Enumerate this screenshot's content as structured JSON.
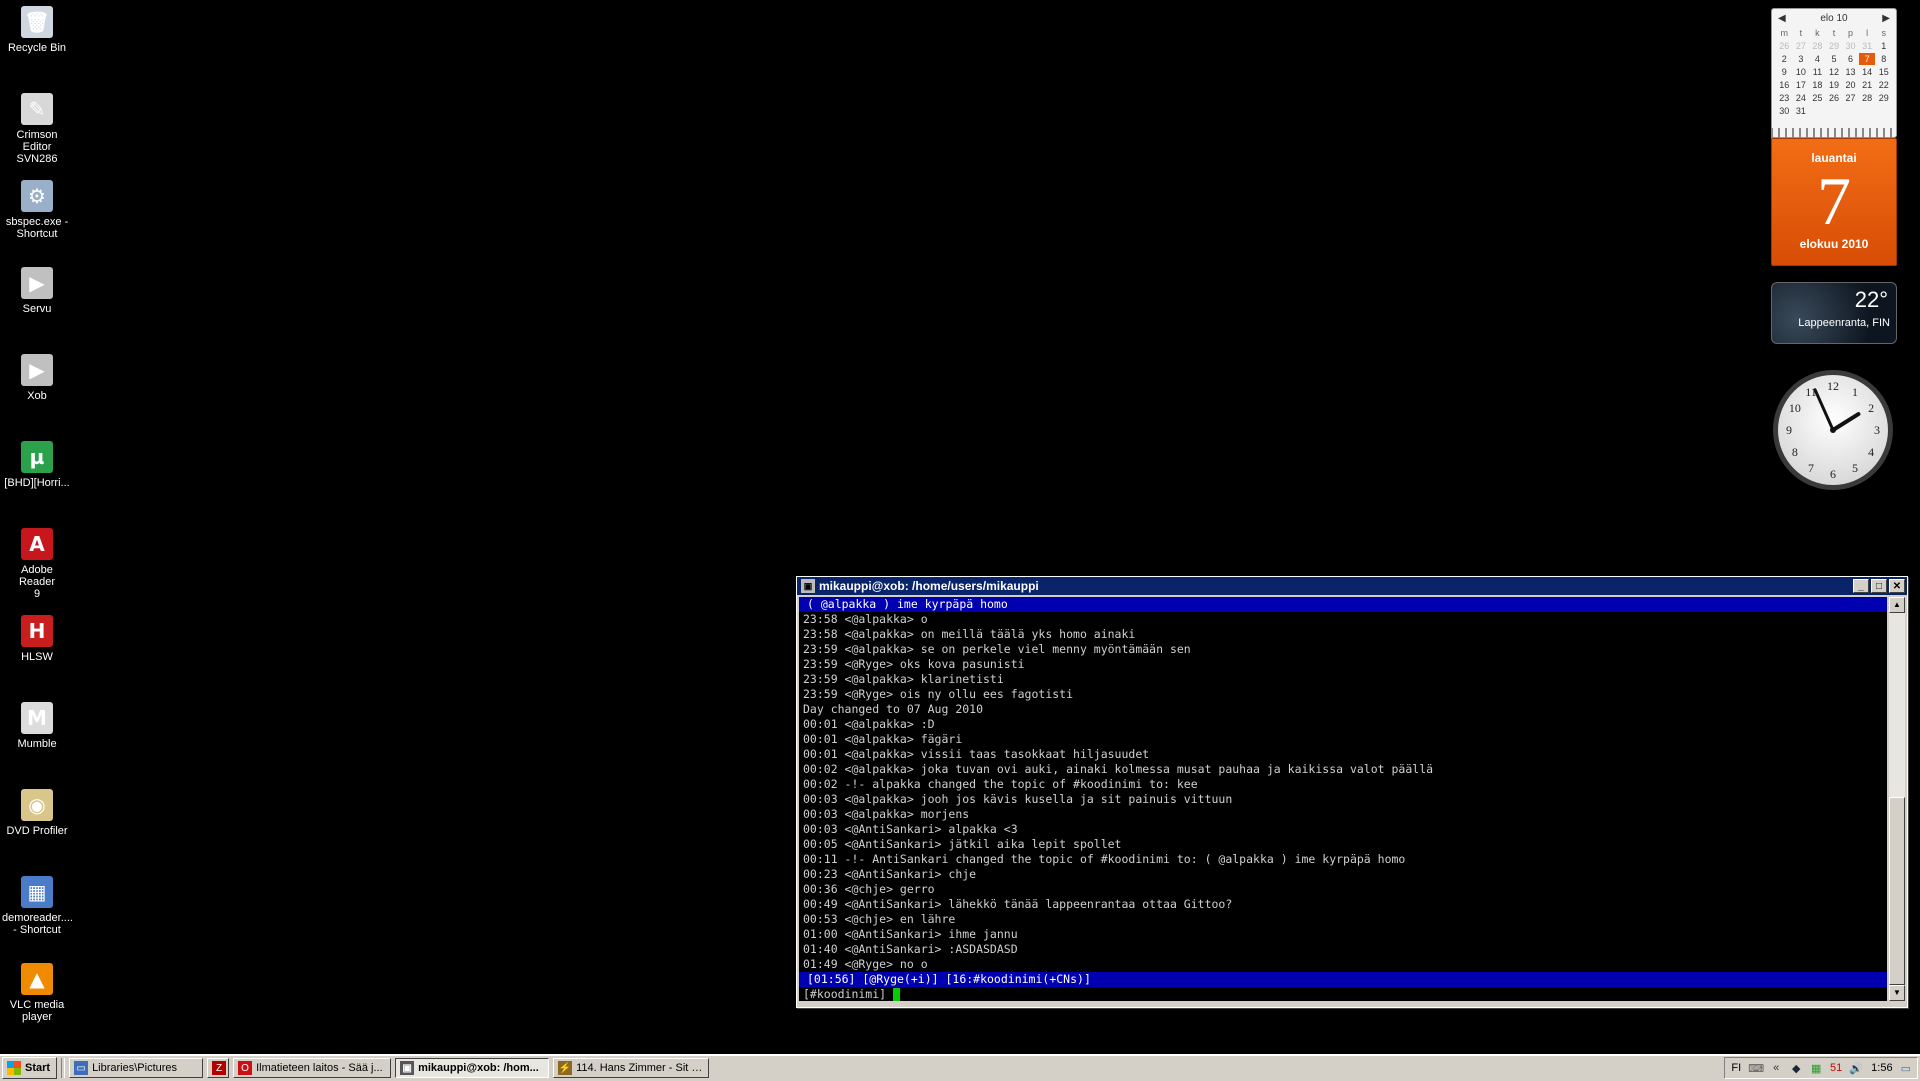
{
  "desktop": {
    "icons": [
      {
        "label": "Recycle Bin",
        "glyph": "🗑",
        "color": "#cfd8e0",
        "icon": "recycle-bin-icon"
      },
      {
        "label": "Crimson Editor\nSVN286",
        "glyph": "✎",
        "color": "#d8d8d8",
        "icon": "crimson-editor-icon"
      },
      {
        "label": "sbspec.exe -\nShortcut",
        "glyph": "⚙",
        "color": "#9ab0c8",
        "icon": "sbspec-icon"
      },
      {
        "label": "Servu",
        "glyph": "▶",
        "color": "#c0c0c0",
        "icon": "servu-icon"
      },
      {
        "label": "Xob",
        "glyph": "▶",
        "color": "#c0c0c0",
        "icon": "xob-icon"
      },
      {
        "label": "[BHD][Horri...",
        "glyph": "µ",
        "color": "#2aa14a",
        "icon": "utorrent-icon"
      },
      {
        "label": "Adobe Reader\n9",
        "glyph": "A",
        "color": "#c8161d",
        "icon": "adobe-reader-icon"
      },
      {
        "label": "HLSW",
        "glyph": "H",
        "color": "#c81e1e",
        "icon": "hlsw-icon"
      },
      {
        "label": "Mumble",
        "glyph": "M",
        "color": "#dcdcdc",
        "icon": "mumble-icon"
      },
      {
        "label": "DVD Profiler",
        "glyph": "◉",
        "color": "#d9c68a",
        "icon": "dvd-profiler-icon"
      },
      {
        "label": "demoreader....\n- Shortcut",
        "glyph": "▦",
        "color": "#4a7cc8",
        "icon": "demoreader-icon"
      },
      {
        "label": "VLC media\nplayer",
        "glyph": "▲",
        "color": "#f08a00",
        "icon": "vlc-icon"
      }
    ]
  },
  "calendar": {
    "month_label": "elo 10",
    "weekdays": [
      "m",
      "t",
      "k",
      "t",
      "p",
      "l",
      "s"
    ],
    "days": [
      {
        "d": "26",
        "muted": true
      },
      {
        "d": "27",
        "muted": true
      },
      {
        "d": "28",
        "muted": true
      },
      {
        "d": "29",
        "muted": true
      },
      {
        "d": "30",
        "muted": true
      },
      {
        "d": "31",
        "muted": true
      },
      {
        "d": "1"
      },
      {
        "d": "2"
      },
      {
        "d": "3"
      },
      {
        "d": "4"
      },
      {
        "d": "5"
      },
      {
        "d": "6"
      },
      {
        "d": "7",
        "today": true
      },
      {
        "d": "8"
      },
      {
        "d": "9"
      },
      {
        "d": "10"
      },
      {
        "d": "11"
      },
      {
        "d": "12"
      },
      {
        "d": "13"
      },
      {
        "d": "14"
      },
      {
        "d": "15"
      },
      {
        "d": "16"
      },
      {
        "d": "17"
      },
      {
        "d": "18"
      },
      {
        "d": "19"
      },
      {
        "d": "20"
      },
      {
        "d": "21"
      },
      {
        "d": "22"
      },
      {
        "d": "23"
      },
      {
        "d": "24"
      },
      {
        "d": "25"
      },
      {
        "d": "26"
      },
      {
        "d": "27"
      },
      {
        "d": "28"
      },
      {
        "d": "29"
      },
      {
        "d": "30"
      },
      {
        "d": "31"
      }
    ],
    "day_name": "lauantai",
    "day_number": "7",
    "month_year": "elokuu 2010"
  },
  "weather": {
    "temp": "22°",
    "location": "Lappeenranta, FIN"
  },
  "clock": {
    "hour": 1,
    "minute": 56
  },
  "terminal": {
    "title": "mikauppi@xob: /home/users/mikauppi",
    "topic": "( @alpakka ) ime kyrpäpä homo",
    "lines": [
      "23:58 <@alpakka> o",
      "23:58 <@alpakka> on meillä täälä yks homo ainaki",
      "23:59 <@alpakka> se on perkele viel menny myöntämään sen",
      "23:59 <@Ryge> oks kova pasunisti",
      "23:59 <@alpakka> klarinetisti",
      "23:59 <@Ryge> ois ny ollu ees fagotisti",
      "Day changed to 07 Aug 2010",
      "00:01 <@alpakka> :D",
      "00:01 <@alpakka> fägäri",
      "00:01 <@alpakka> vissii taas tasokkaat hiljasuudet",
      "00:02 <@alpakka> joka tuvan ovi auki, ainaki kolmessa musat pauhaa ja kaikissa valot päällä",
      "00:02 -!- alpakka changed the topic of #koodinimi to: kee",
      "00:03 <@alpakka> jooh jos kävis kusella ja sit painuis vittuun",
      "00:03 <@alpakka> morjens",
      "00:03 <@AntiSankari> alpakka <3",
      "00:05 <@AntiSankari> jätkil aika lepit spollet",
      "00:11 -!- AntiSankari changed the topic of #koodinimi to: ( @alpakka ) ime kyrpäpä homo",
      "00:23 <@AntiSankari> chje",
      "00:36 <@chje> gerro",
      "00:49 <@AntiSankari> lähekkö tänää lappeenrantaa ottaa Gittoo?",
      "00:53 <@chje> en lähre",
      "01:00 <@AntiSankari> ihme jannu",
      "01:40 <@AntiSankari> :ASDASDASD",
      "01:49 <@Ryge> no o"
    ],
    "status": "[01:56] [@Ryge(+i)] [16:#koodinimi(+CNs)]",
    "input_prompt": "[#koodinimi] "
  },
  "taskbar": {
    "start_label": "Start",
    "tasks": [
      {
        "label": "Libraries\\Pictures",
        "icon": "folder-icon",
        "glyph": "▭",
        "color": "#3d6fb6",
        "width": 134
      },
      {
        "label": "",
        "icon": "filezilla-icon",
        "glyph": "Z",
        "color": "#b00000",
        "width": 22
      },
      {
        "label": "Ilmatieteen laitos - Sää j...",
        "icon": "opera-icon",
        "glyph": "O",
        "color": "#cc0f16",
        "width": 158
      },
      {
        "label": "mikauppi@xob: /hom...",
        "icon": "putty-icon",
        "glyph": "▣",
        "color": "#555555",
        "width": 154,
        "active": true
      },
      {
        "label": "114. Hans Zimmer - Sit B...",
        "icon": "winamp-icon",
        "glyph": "⚡",
        "color": "#8a6a20",
        "width": 156
      }
    ],
    "tray": {
      "language": "FI",
      "items": [
        {
          "icon": "keyboard-icon",
          "glyph": "⌨",
          "color": "#555555"
        },
        {
          "icon": "show-hidden-icon",
          "glyph": "«",
          "color": "#333333"
        },
        {
          "icon": "steam-icon",
          "glyph": "◆",
          "color": "#1b2838"
        },
        {
          "icon": "network-icon",
          "glyph": "▦",
          "color": "#2a9a2a"
        },
        {
          "icon": "counter-icon",
          "glyph": "51",
          "color": "#cc0000"
        },
        {
          "icon": "volume-icon",
          "glyph": "🔊",
          "color": "#555555"
        }
      ],
      "time": "1:56",
      "show_desktop_icon": "▭"
    }
  }
}
